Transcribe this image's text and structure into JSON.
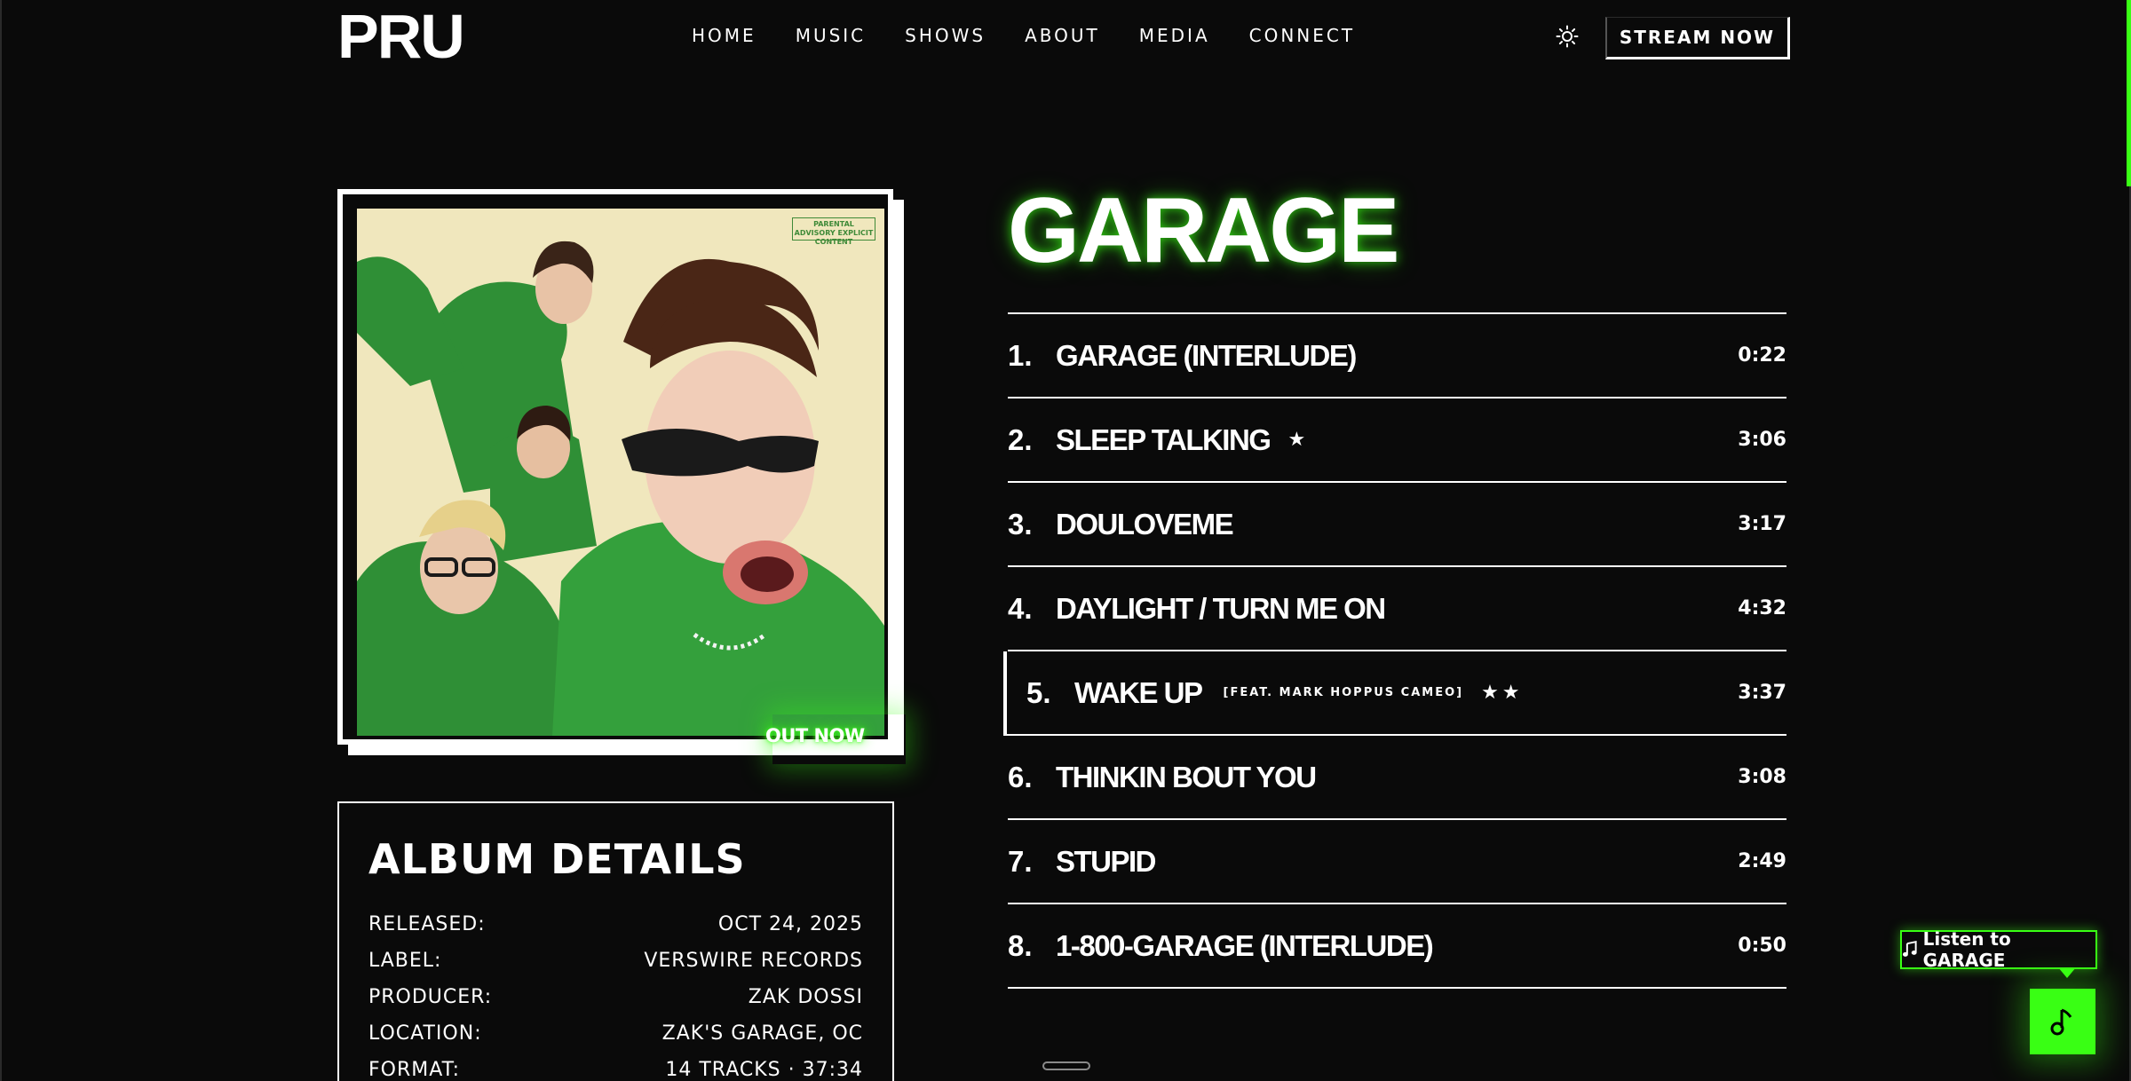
{
  "nav": {
    "logo": "PRU",
    "links": [
      "HOME",
      "MUSIC",
      "SHOWS",
      "ABOUT",
      "MEDIA",
      "CONNECT"
    ],
    "theme_icon": "sun-icon",
    "stream_label": "STREAM NOW"
  },
  "album": {
    "title": "GARAGE",
    "cover_advisory": "PARENTAL ADVISORY EXPLICIT CONTENT",
    "out_now": "OUT NOW"
  },
  "details": {
    "heading": "ALBUM DETAILS",
    "rows": [
      {
        "label": "RELEASED:",
        "value": "OCT 24, 2025"
      },
      {
        "label": "LABEL:",
        "value": "VERSWIRE RECORDS"
      },
      {
        "label": "PRODUCER:",
        "value": "ZAK DOSSI"
      },
      {
        "label": "LOCATION:",
        "value": "ZAK'S GARAGE, OC"
      },
      {
        "label": "FORMAT:",
        "value": "14 TRACKS · 37:34"
      }
    ]
  },
  "tracks": [
    {
      "num": "1.",
      "title": "GARAGE (INTERLUDE)",
      "feat": "",
      "stars": "",
      "duration": "0:22"
    },
    {
      "num": "2.",
      "title": "SLEEP TALKING",
      "feat": "",
      "stars": "★",
      "duration": "3:06"
    },
    {
      "num": "3.",
      "title": "DOULOVEME",
      "feat": "",
      "stars": "",
      "duration": "3:17"
    },
    {
      "num": "4.",
      "title": "DAYLIGHT / TURN ME ON",
      "feat": "",
      "stars": "",
      "duration": "4:32"
    },
    {
      "num": "5.",
      "title": "WAKE UP",
      "feat": "[FEAT. MARK HOPPUS CAMEO]",
      "stars": "★★",
      "duration": "3:37"
    },
    {
      "num": "6.",
      "title": "THINKIN BOUT YOU",
      "feat": "",
      "stars": "",
      "duration": "3:08"
    },
    {
      "num": "7.",
      "title": "STUPID",
      "feat": "",
      "stars": "",
      "duration": "2:49"
    },
    {
      "num": "8.",
      "title": "1-800-GARAGE (INTERLUDE)",
      "feat": "",
      "stars": "",
      "duration": "0:50"
    }
  ],
  "player": {
    "tooltip_icon": "music-note-icon",
    "tooltip_label": "Listen to GARAGE",
    "fab_icon": "music-note-icon"
  },
  "colors": {
    "accent": "#39ff14",
    "background": "#0a0a0a",
    "text": "#ffffff",
    "cover_bg": "#f0e7bd",
    "jacket_green": "#2f8f36"
  }
}
